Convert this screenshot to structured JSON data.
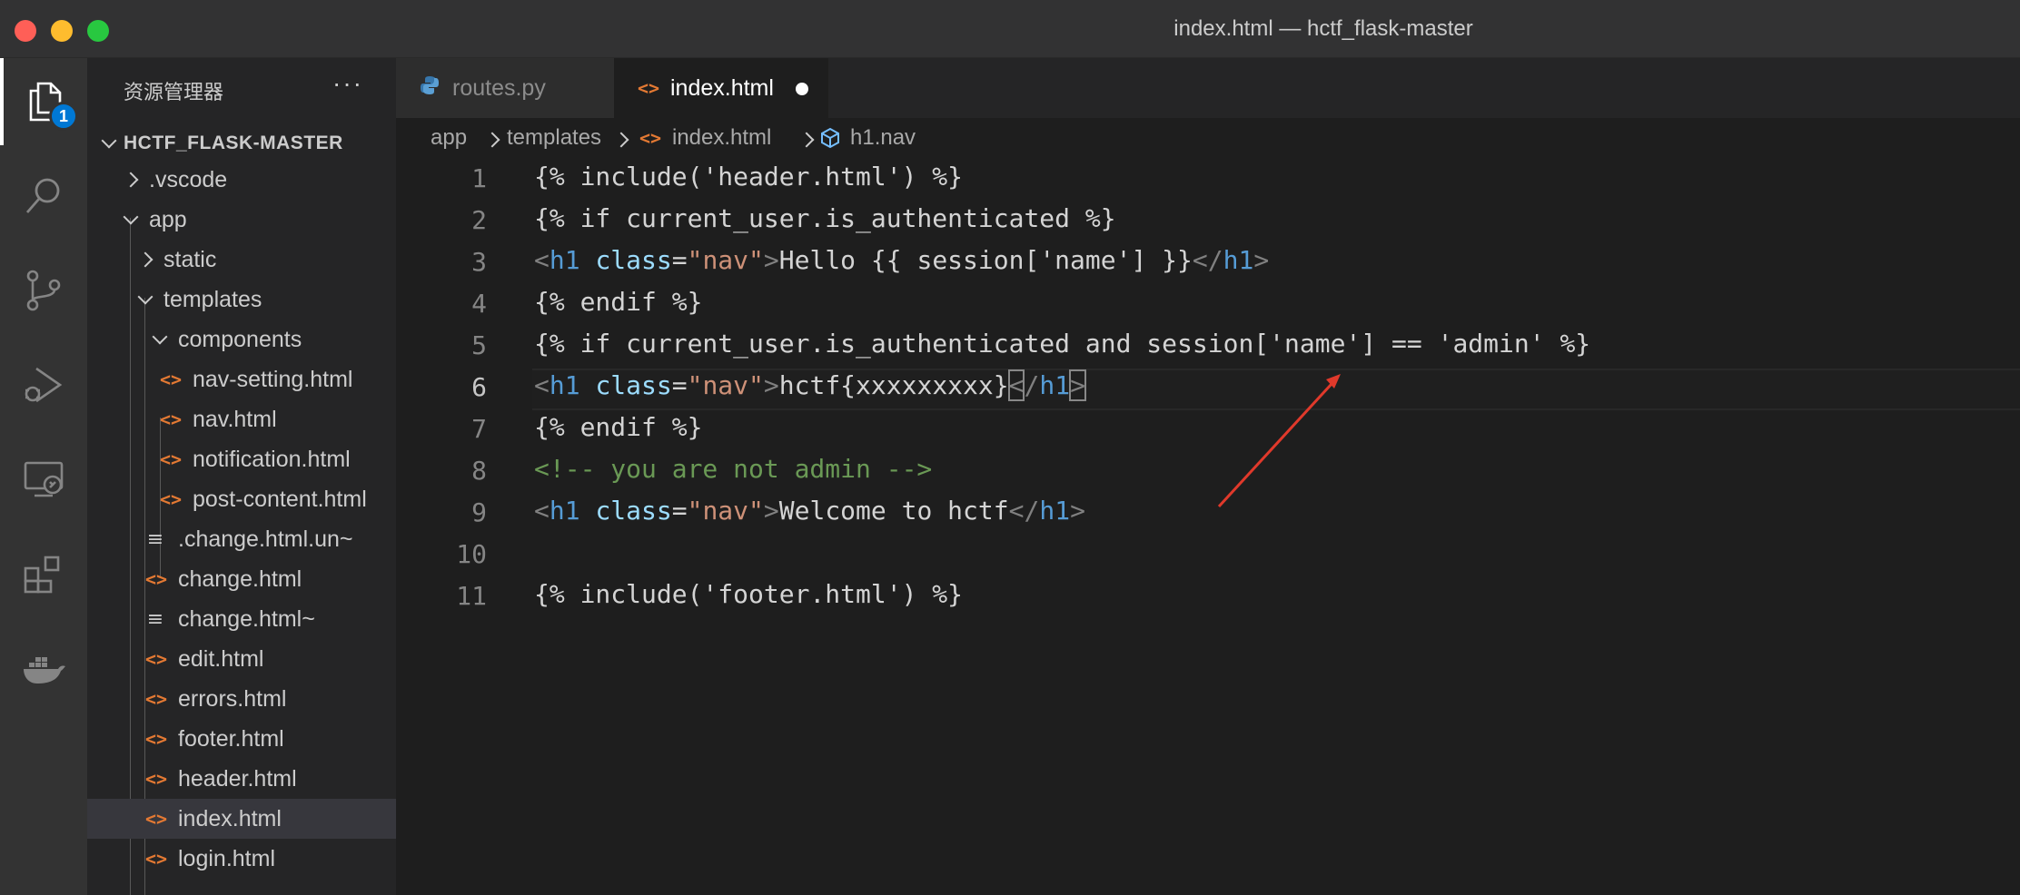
{
  "window": {
    "title": "index.html — hctf_flask-master"
  },
  "activity_bar": {
    "items": [
      "explorer-icon",
      "search-icon",
      "source-control-icon",
      "run-debug-icon",
      "remote-explorer-icon",
      "extensions-icon",
      "docker-icon"
    ],
    "explorer_badge": "1"
  },
  "sidebar": {
    "title": "资源管理器",
    "more": "···",
    "root": "HCTF_FLASK-MASTER",
    "items": [
      {
        "label": ".vscode",
        "icon": "chevron-right-icon"
      },
      {
        "label": "app",
        "icon": "chevron-down-icon"
      },
      {
        "label": "static",
        "icon": "chevron-right-icon"
      },
      {
        "label": "templates",
        "icon": "chevron-down-icon"
      },
      {
        "label": "components",
        "icon": "chevron-down-icon"
      },
      {
        "label": "nav-setting.html",
        "icon": "html-file-icon"
      },
      {
        "label": "nav.html",
        "icon": "html-file-icon"
      },
      {
        "label": "notification.html",
        "icon": "html-file-icon"
      },
      {
        "label": "post-content.html",
        "icon": "html-file-icon"
      },
      {
        "label": ".change.html.un~",
        "icon": "text-file-icon"
      },
      {
        "label": "change.html",
        "icon": "html-file-icon"
      },
      {
        "label": "change.html~",
        "icon": "text-file-icon"
      },
      {
        "label": "edit.html",
        "icon": "html-file-icon"
      },
      {
        "label": "errors.html",
        "icon": "html-file-icon"
      },
      {
        "label": "footer.html",
        "icon": "html-file-icon"
      },
      {
        "label": "header.html",
        "icon": "html-file-icon"
      },
      {
        "label": "index.html",
        "icon": "html-file-icon",
        "selected": true
      },
      {
        "label": "login.html",
        "icon": "html-file-icon"
      }
    ]
  },
  "tabs": [
    {
      "label": "routes.py",
      "icon": "python-icon",
      "active": false
    },
    {
      "label": "index.html",
      "icon": "html-file-icon",
      "active": true,
      "modified": true
    }
  ],
  "breadcrumb": [
    "app",
    "templates",
    "index.html",
    "h1.nav"
  ],
  "editor": {
    "current_line": 6,
    "lines": [
      {
        "n": "1",
        "code": "{% include('header.html') %}"
      },
      {
        "n": "2",
        "code": "{% if current_user.is_authenticated %}"
      },
      {
        "n": "3",
        "code": "<h1 class=\"nav\">Hello {{ session['name'] }}</h1>"
      },
      {
        "n": "4",
        "code": "{% endif %}"
      },
      {
        "n": "5",
        "code": "{% if current_user.is_authenticated and session['name'] == 'admin' %}"
      },
      {
        "n": "6",
        "code": "<h1 class=\"nav\">hctf{xxxxxxxxx}</h1>"
      },
      {
        "n": "7",
        "code": "{% endif %}"
      },
      {
        "n": "8",
        "code": "<!-- you are not admin -->"
      },
      {
        "n": "9",
        "code": "<h1 class=\"nav\">Welcome to hctf</h1>"
      },
      {
        "n": "10",
        "code": ""
      },
      {
        "n": "11",
        "code": "{% include('footer.html') %}"
      }
    ]
  },
  "colors": {
    "accent": "#0078d4",
    "annotation_arrow": "#e0392b",
    "html_icon": "#e37933"
  }
}
